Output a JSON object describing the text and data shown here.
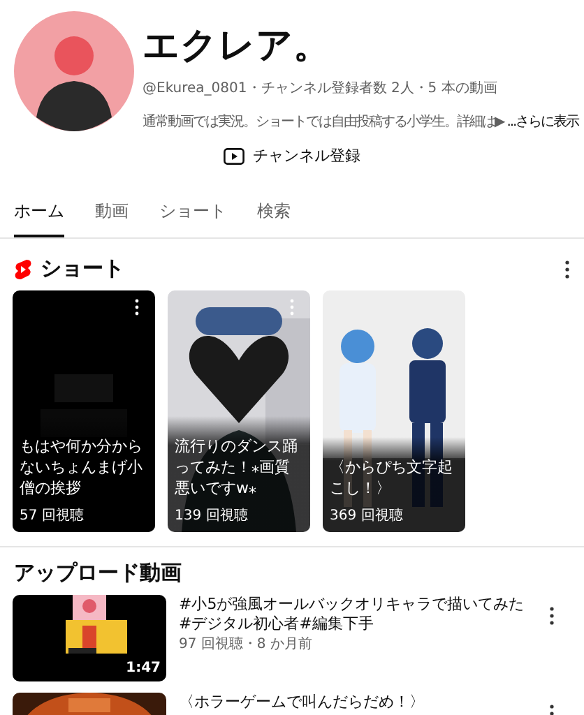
{
  "channel": {
    "name": "エクレア。",
    "meta": "@Ekurea_0801・チャンネル登録者数 2人・5 本の動画",
    "description": "通常動画では実況。ショートでは自由投稿する小学生。詳細は▶",
    "more": "...さらに表示",
    "subscribe": "チャンネル登録"
  },
  "tabs": [
    {
      "label": "ホーム",
      "selected": true
    },
    {
      "label": "動画",
      "selected": false
    },
    {
      "label": "ショート",
      "selected": false
    },
    {
      "label": "検索",
      "selected": false
    }
  ],
  "shorts": {
    "title": "ショート",
    "items": [
      {
        "title": "もはや何か分からないちょんまげ小僧の挨拶",
        "views": "57 回視聴",
        "menu": true
      },
      {
        "title": "流行りのダンス踊ってみた！⁎画質悪いですw⁎",
        "views": "139 回視聴",
        "menu": true
      },
      {
        "title": "〈からぴち文字起こし！〉",
        "views": "369 回視聴",
        "menu": false
      }
    ]
  },
  "uploads": {
    "title": "アップロード動画",
    "items": [
      {
        "title": "#小5が強風オールバックオリキャラで描いてみた#デジタル初心者#編集下手",
        "meta": "97 回視聴・8 か月前",
        "duration": "1:47"
      },
      {
        "title": "〈ホラーゲームで叫んだらだめ！〉"
      }
    ]
  }
}
